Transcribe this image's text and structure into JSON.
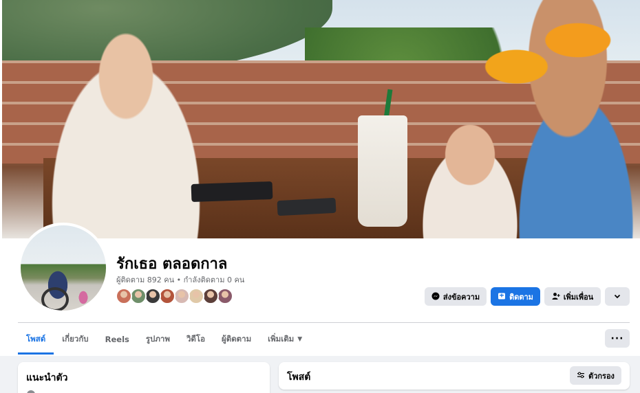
{
  "profile": {
    "name": "รักเธอ ตลอดกาล",
    "followers_text": "ผู้ติดตาม 892 คน • กำลังติดตาม 0 คน",
    "follower_avatar_colors": [
      "#c9705a",
      "#6f8f6a",
      "#3a3a3a",
      "#b3543b",
      "#d7b9b3",
      "#e0c9a8",
      "#5c3f3a",
      "#8a5a6a"
    ]
  },
  "actions": {
    "message_label": "ส่งข้อความ",
    "follow_label": "ติดตาม",
    "add_friend_label": "เพิ่มเพื่อน",
    "message_icon": "messenger-icon",
    "follow_icon": "follow-icon",
    "add_friend_icon": "add-friend-icon",
    "more_icon": "chevron-down-icon"
  },
  "tabs": [
    {
      "label": "โพสต์",
      "active": true
    },
    {
      "label": "เกี่ยวกับ",
      "active": false
    },
    {
      "label": "Reels",
      "active": false
    },
    {
      "label": "รูปภาพ",
      "active": false
    },
    {
      "label": "วิดีโอ",
      "active": false
    },
    {
      "label": "ผู้ติดตาม",
      "active": false
    },
    {
      "label": "เพิ่มเติม",
      "active": false
    }
  ],
  "tabs_more_icon": "more-icon",
  "intro": {
    "title": "แนะนำตัว"
  },
  "posts": {
    "title": "โพสต์",
    "filter_label": "ตัวกรอง",
    "filter_icon": "filter-icon"
  },
  "colors": {
    "accent": "#1b74e4",
    "button_gray": "#e4e6eb",
    "background": "#f0f2f5",
    "secondary_text": "#65676b"
  }
}
